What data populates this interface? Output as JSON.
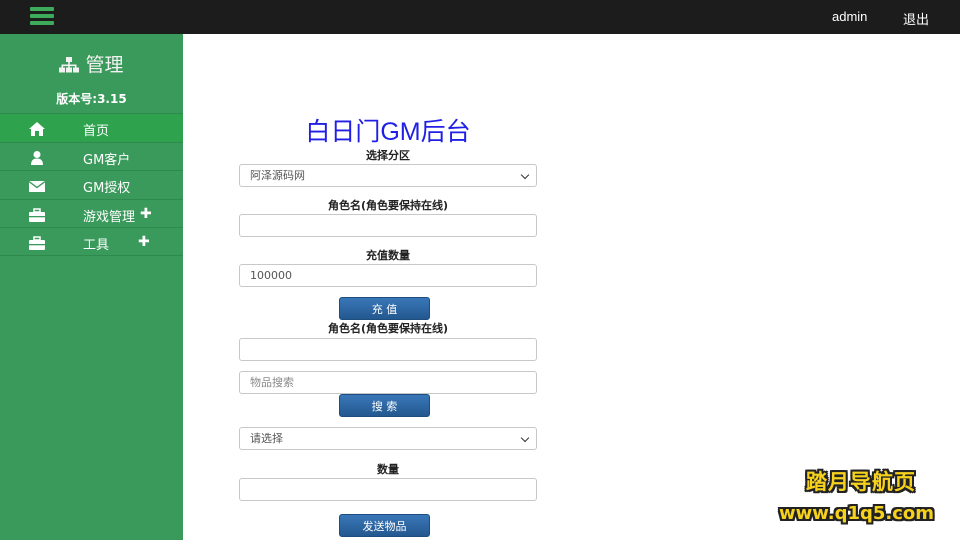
{
  "header": {
    "user": "admin",
    "logout_label": "退出"
  },
  "sidebar": {
    "title": "管理",
    "version": "版本号:3.15",
    "items": [
      {
        "label": "首页",
        "icon": "home-icon"
      },
      {
        "label": "GM客户",
        "icon": "user-icon"
      },
      {
        "label": "GM授权",
        "icon": "envelope-icon"
      },
      {
        "label": "游戏管理",
        "icon": "briefcase-icon",
        "expand": "✚"
      },
      {
        "label": "工具",
        "icon": "briefcase-icon",
        "expand": "✚"
      }
    ]
  },
  "form": {
    "title": "白日门GM后台",
    "server_label": "选择分区",
    "server_value": "阿泽源码网",
    "role_label": "角色名(角色要保持在线)",
    "role_value": "",
    "amount_label": "充值数量",
    "amount_value": "100000",
    "recharge_button": "充 值",
    "role2_label": "角色名(角色要保持在线)",
    "role2_value": "",
    "item_search_placeholder": "物品搜索",
    "search_button": "搜 索",
    "item_select_value": "请选择",
    "quantity_label": "数量",
    "quantity_value": "",
    "send_button": "发送物品"
  },
  "watermark": {
    "line1": "踏月导航页",
    "line2": "www.q1q5.com"
  },
  "colors": {
    "topbar": "#1c1c1c",
    "sidebar": "#3a9a5b",
    "sidebar_active": "#2ea24d",
    "title_blue": "#1f1fe6",
    "button_blue": "#2c66a4",
    "watermark_yellow": "#f6d21c"
  }
}
